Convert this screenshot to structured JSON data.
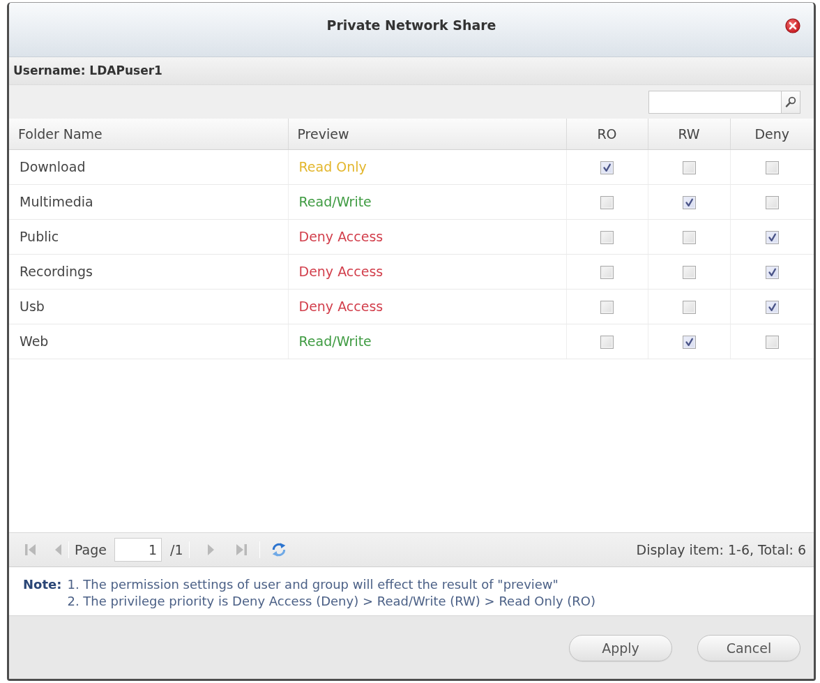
{
  "window": {
    "title": "Private Network Share"
  },
  "user_bar": {
    "label": "Username: LDAPuser1"
  },
  "table": {
    "columns": [
      {
        "label": "Folder Name",
        "kind": "text"
      },
      {
        "label": "Preview",
        "kind": "text"
      },
      {
        "label": "RO",
        "kind": "check"
      },
      {
        "label": "RW",
        "kind": "check"
      },
      {
        "label": "Deny",
        "kind": "check"
      }
    ],
    "rows": [
      {
        "folder": "Download",
        "preview": {
          "text": "Read Only",
          "color": "#e3b62c"
        },
        "ro_checked": true,
        "rw_checked": false,
        "deny_checked": false
      },
      {
        "folder": "Multimedia",
        "preview": {
          "text": "Read/Write",
          "color": "#3f9b42"
        },
        "ro_checked": false,
        "rw_checked": true,
        "deny_checked": false
      },
      {
        "folder": "Public",
        "preview": {
          "text": "Deny Access",
          "color": "#d23f4c"
        },
        "ro_checked": false,
        "rw_checked": false,
        "deny_checked": true
      },
      {
        "folder": "Recordings",
        "preview": {
          "text": "Deny Access",
          "color": "#d23f4c"
        },
        "ro_checked": false,
        "rw_checked": false,
        "deny_checked": true
      },
      {
        "folder": "Usb",
        "preview": {
          "text": "Deny Access",
          "color": "#d23f4c"
        },
        "ro_checked": false,
        "rw_checked": false,
        "deny_checked": true
      },
      {
        "folder": "Web",
        "preview": {
          "text": "Read/Write",
          "color": "#3f9b42"
        },
        "ro_checked": false,
        "rw_checked": true,
        "deny_checked": false
      }
    ]
  },
  "pager": {
    "buttons": [
      {
        "kind": "first",
        "disabled": true
      },
      {
        "kind": "prev",
        "disabled": true
      },
      {
        "kind": "next",
        "disabled": true
      },
      {
        "kind": "last",
        "disabled": true
      },
      {
        "kind": "refresh",
        "disabled": false
      }
    ],
    "page_label": "Page",
    "page_value": "1",
    "page_count": "/1",
    "summary": "Display item: 1-6, Total: 6"
  },
  "note": {
    "label": "Note:",
    "lines": [
      "1. The permission settings of user and group will effect the result of \"preview\"",
      "2. The privilege priority is Deny Access (Deny) > Read/Write (RW) > Read Only (RO)"
    ]
  },
  "buttons": [
    "Apply",
    "Cancel"
  ]
}
